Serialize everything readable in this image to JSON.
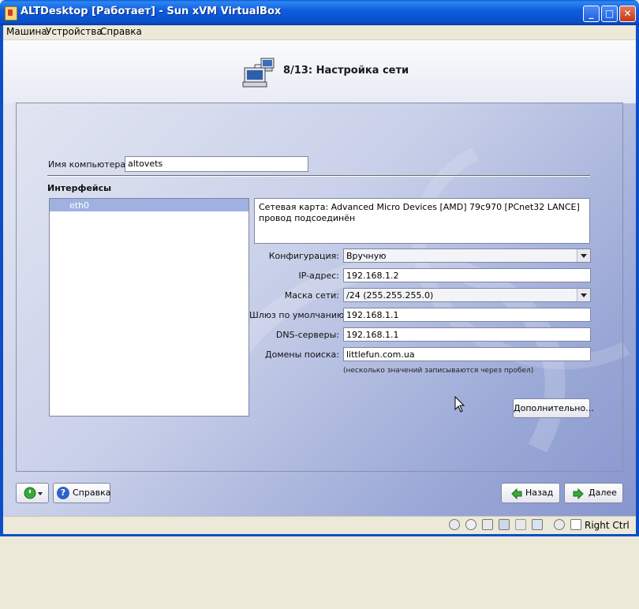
{
  "window": {
    "title": "ALTDesktop [Работает] - Sun xVM VirtualBox"
  },
  "menu": {
    "items": [
      "Машина",
      "Устройства",
      "Справка"
    ]
  },
  "wizard": {
    "step_title": "8/13: Настройка сети"
  },
  "form": {
    "hostname_label": "Имя компьютера:",
    "hostname_value": "altovets",
    "interfaces_heading": "Интерфейсы",
    "interfaces": [
      "eth0"
    ],
    "card_info_line1": "Сетевая карта: Advanced Micro Devices [AMD] 79c970 [PCnet32 LANCE]",
    "card_info_line2": "провод подсоединён",
    "config_label": "Конфигурация:",
    "config_value": "Вручную",
    "ip_label": "IP-адрес:",
    "ip_value": "192.168.1.2",
    "mask_label": "Маска сети:",
    "mask_value": "/24 (255.255.255.0)",
    "gateway_label": "Шлюз по умолчанию:",
    "gateway_value": "192.168.1.1",
    "dns_label": "DNS-серверы:",
    "dns_value": "192.168.1.1",
    "search_label": "Домены поиска:",
    "search_value": "littlefun.com.ua",
    "hint": "(несколько значений записываются через пробел)",
    "advanced_button": "Дополнительно..."
  },
  "footer": {
    "help_button": "Справка",
    "back_button": "Назад",
    "next_button": "Далее"
  },
  "statusbar": {
    "host_key": "Right Ctrl"
  },
  "colors": {
    "title_bar": "#0a4fc8",
    "selection": "#9fb1e0",
    "arrow_green": "#3aa83a"
  }
}
